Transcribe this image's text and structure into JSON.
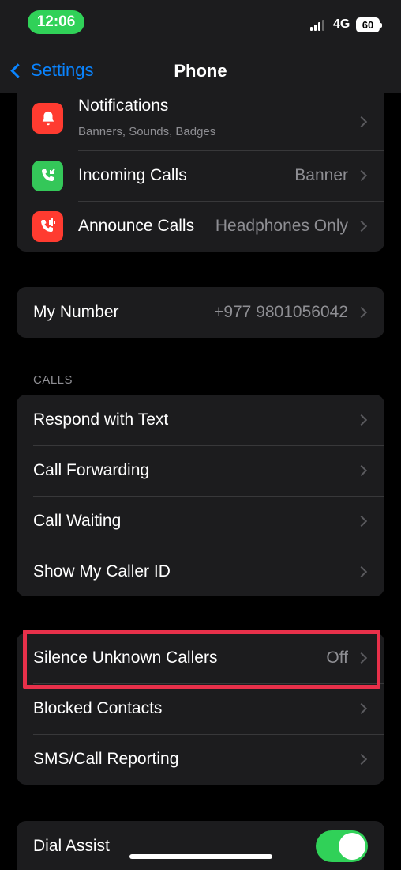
{
  "status_bar": {
    "time": "12:06",
    "network": "4G",
    "battery": "60"
  },
  "nav": {
    "back_label": "Settings",
    "title": "Phone"
  },
  "notifications_group": {
    "items": [
      {
        "label": "Notifications",
        "subtitle": "Banners, Sounds, Badges",
        "value": "",
        "icon": "bell-icon",
        "icon_color": "#ff3b30"
      },
      {
        "label": "Incoming Calls",
        "value": "Banner",
        "icon": "incoming-call-icon",
        "icon_color": "#34c759"
      },
      {
        "label": "Announce Calls",
        "value": "Headphones Only",
        "icon": "announce-calls-icon",
        "icon_color": "#ff3b30"
      }
    ]
  },
  "my_number": {
    "label": "My Number",
    "value": "+977 9801056042"
  },
  "calls_section": {
    "header": "CALLS",
    "items": [
      {
        "label": "Respond with Text"
      },
      {
        "label": "Call Forwarding"
      },
      {
        "label": "Call Waiting"
      },
      {
        "label": "Show My Caller ID"
      }
    ]
  },
  "blocking_group": {
    "items": [
      {
        "label": "Silence Unknown Callers",
        "value": "Off"
      },
      {
        "label": "Blocked Contacts"
      },
      {
        "label": "SMS/Call Reporting"
      }
    ]
  },
  "dial_assist": {
    "label": "Dial Assist",
    "enabled": true
  },
  "colors": {
    "accent": "#0a84ff",
    "toggle_on": "#30d158",
    "highlight": "#e8304a"
  }
}
